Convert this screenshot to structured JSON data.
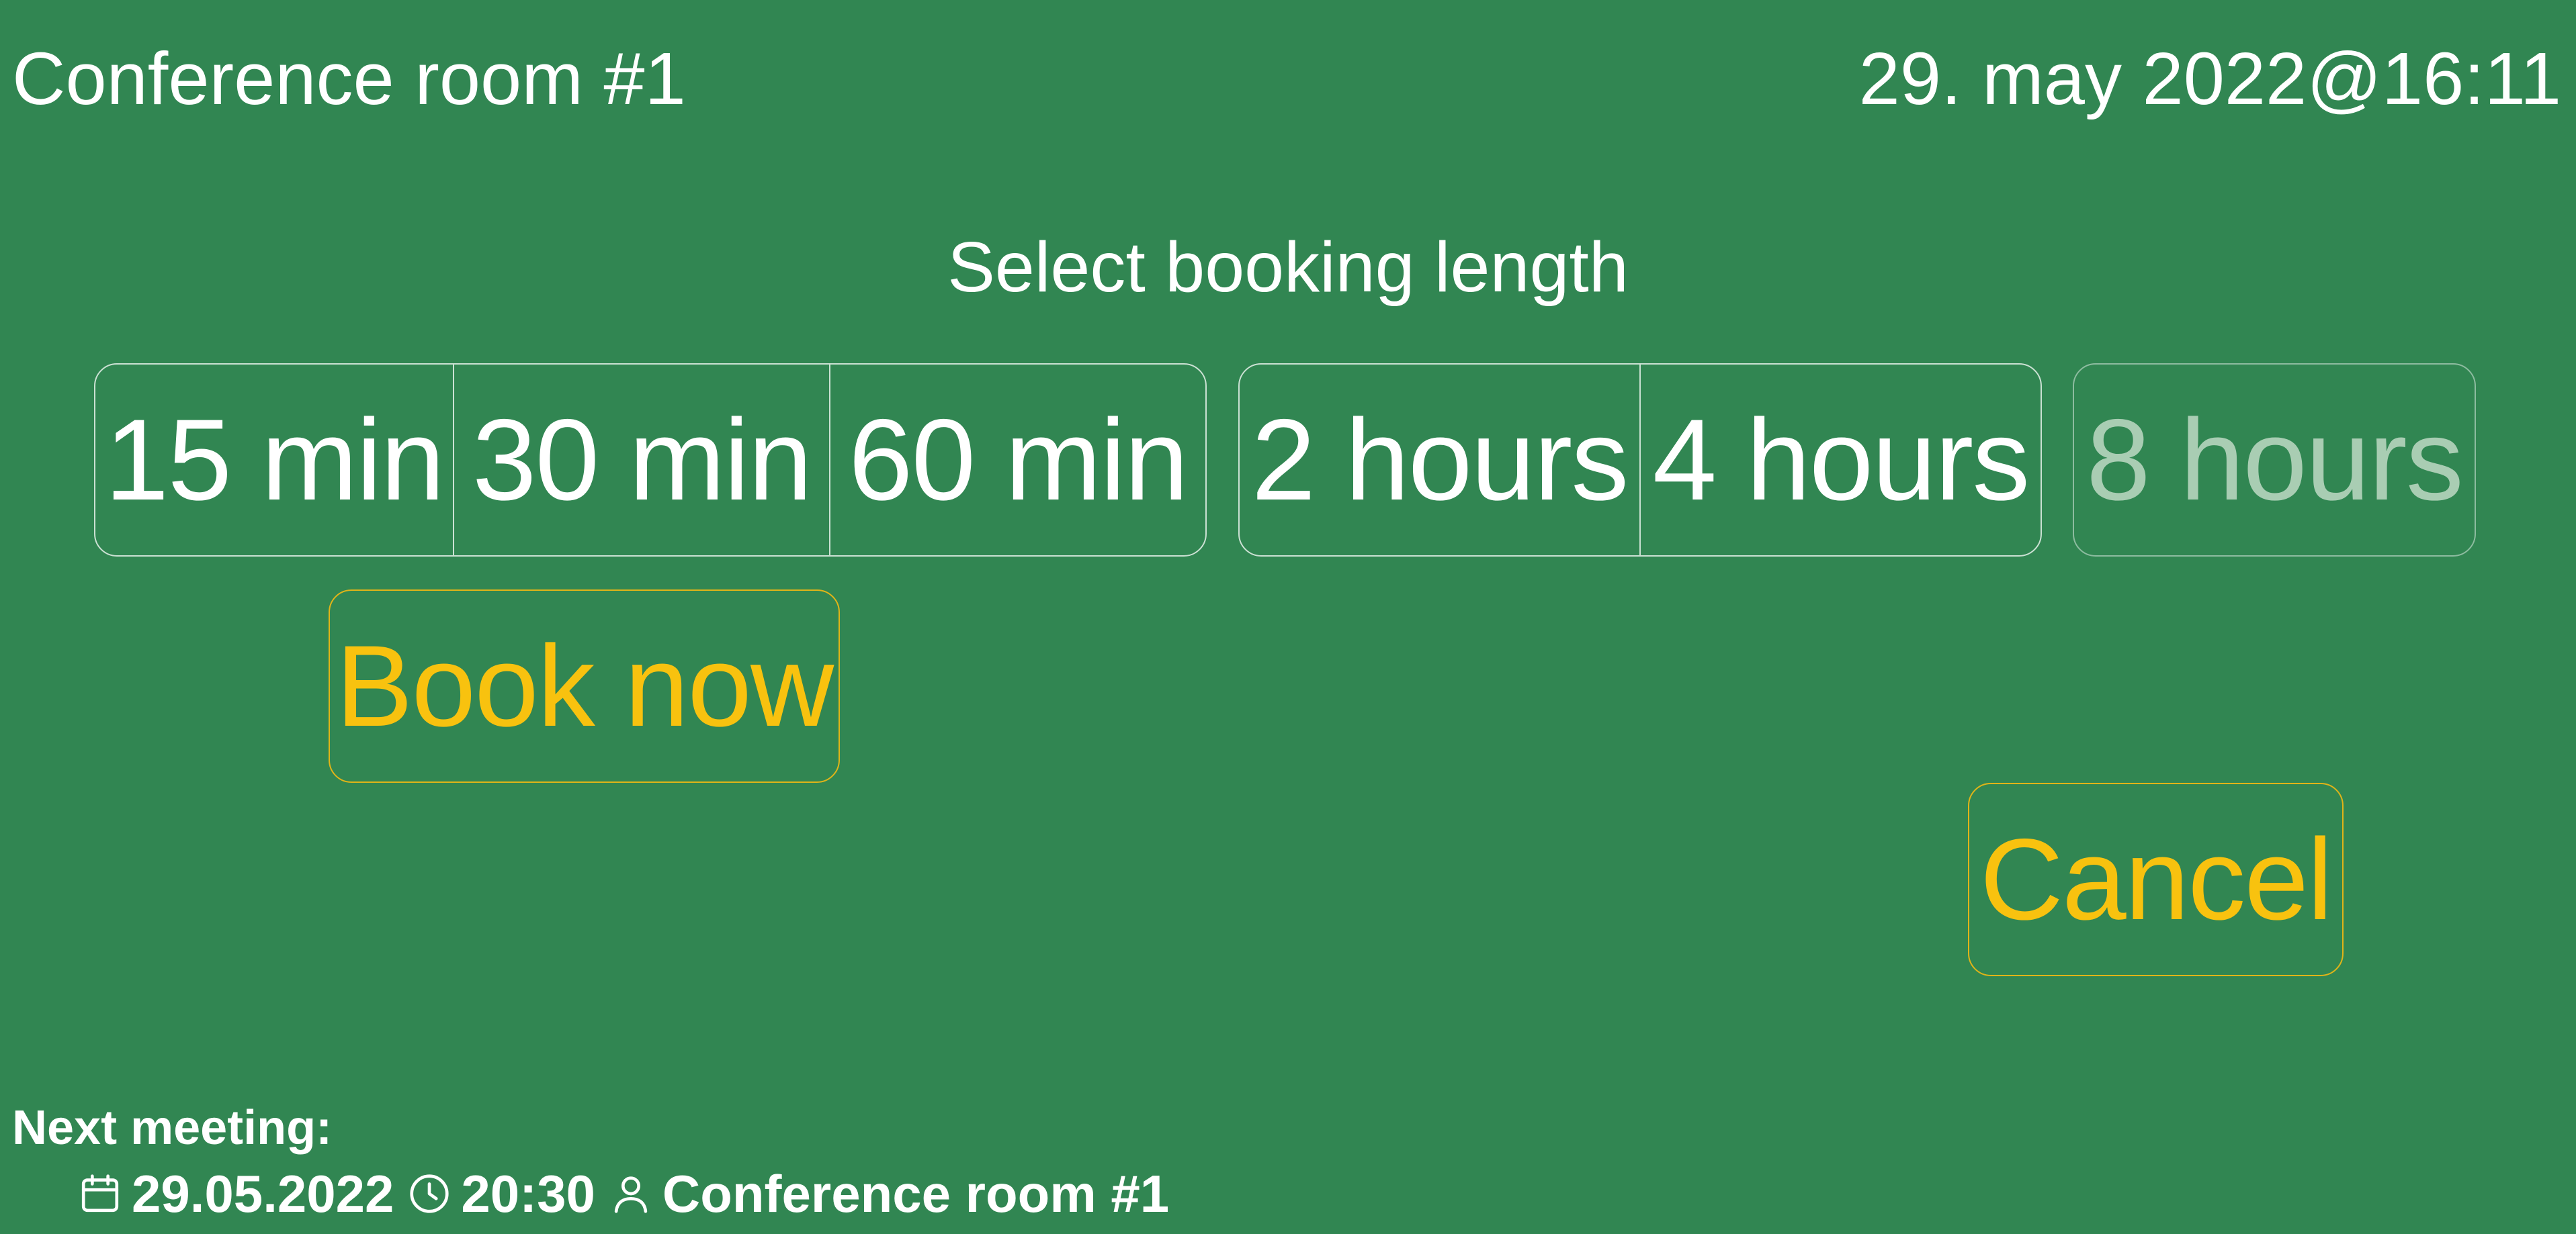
{
  "header": {
    "room_name": "Conference room #1",
    "datetime": "29. may 2022@16:11"
  },
  "prompt": "Select booking length",
  "durations": {
    "group_minutes": [
      "15 min",
      "30 min",
      "60 min"
    ],
    "group_hours": [
      "2 hours",
      "4 hours"
    ],
    "unavailable": "8 hours"
  },
  "actions": {
    "book_label": "Book now",
    "cancel_label": "Cancel"
  },
  "next_meeting": {
    "label": "Next meeting:",
    "date": "29.05.2022",
    "time": "20:30",
    "room": "Conference room #1"
  },
  "colors": {
    "background": "#318652",
    "accent": "#f8c20f",
    "text": "#ffffff",
    "disabled_text": "#a9cdb3"
  },
  "icons": {
    "date": "calendar-icon",
    "time": "clock-icon",
    "room": "person-icon"
  }
}
